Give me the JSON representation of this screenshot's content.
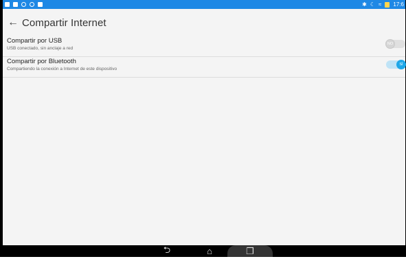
{
  "status_bar": {
    "time": "17:6",
    "color": "#1e88e5",
    "left_icons": [
      "notification-icon",
      "message-icon",
      "phone-icon",
      "app-icon",
      "sdcard-icon"
    ],
    "right_icons": [
      "bluetooth-icon",
      "moon-icon",
      "wifi-icon",
      "battery-charging-icon"
    ]
  },
  "app_bar": {
    "title": "Compartir Internet",
    "back_icon": "←"
  },
  "settings": {
    "items": [
      {
        "title": "Compartir por USB",
        "subtitle": "USB conectado, sin anclaje a red",
        "toggle_label": "NO",
        "checked": false
      },
      {
        "title": "Compartir por Bluetooth",
        "subtitle": "Compartiendo la conexión a Internet de este dispositivo",
        "toggle_label": "SÍ",
        "checked": true
      }
    ]
  },
  "nav_bar": {
    "back": "⮌",
    "home": "⌂",
    "recents": "❐"
  },
  "colors": {
    "accent": "#1ea7e8",
    "background": "#f4f4f4",
    "status_bar": "#1e88e5"
  }
}
